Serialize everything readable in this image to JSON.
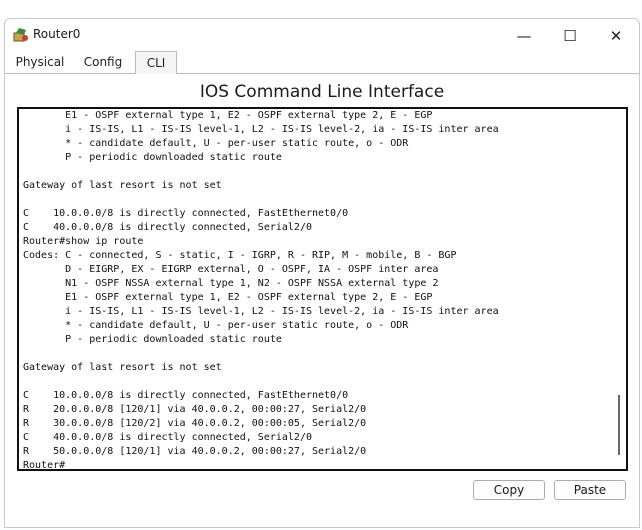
{
  "window": {
    "title": "Router0",
    "icon": "router-icon",
    "controls": {
      "minimize": "—",
      "maximize": "☐",
      "close": "✕"
    }
  },
  "tabs": [
    {
      "label": "Physical",
      "active": false
    },
    {
      "label": "Config",
      "active": false
    },
    {
      "label": "CLI",
      "active": true
    }
  ],
  "cli": {
    "title": "IOS Command Line Interface",
    "lines": [
      "       E1 - OSPF external type 1, E2 - OSPF external type 2, E - EGP",
      "       i - IS-IS, L1 - IS-IS level-1, L2 - IS-IS level-2, ia - IS-IS inter area",
      "       * - candidate default, U - per-user static route, o - ODR",
      "       P - periodic downloaded static route",
      "",
      "Gateway of last resort is not set",
      "",
      "C    10.0.0.0/8 is directly connected, FastEthernet0/0",
      "C    40.0.0.0/8 is directly connected, Serial2/0",
      "Router#show ip route",
      "Codes: C - connected, S - static, I - IGRP, R - RIP, M - mobile, B - BGP",
      "       D - EIGRP, EX - EIGRP external, O - OSPF, IA - OSPF inter area",
      "       N1 - OSPF NSSA external type 1, N2 - OSPF NSSA external type 2",
      "       E1 - OSPF external type 1, E2 - OSPF external type 2, E - EGP",
      "       i - IS-IS, L1 - IS-IS level-1, L2 - IS-IS level-2, ia - IS-IS inter area",
      "       * - candidate default, U - per-user static route, o - ODR",
      "       P - periodic downloaded static route",
      "",
      "Gateway of last resort is not set",
      "",
      "C    10.0.0.0/8 is directly connected, FastEthernet0/0",
      "R    20.0.0.0/8 [120/1] via 40.0.0.2, 00:00:27, Serial2/0",
      "R    30.0.0.0/8 [120/2] via 40.0.0.2, 00:00:05, Serial2/0",
      "C    40.0.0.0/8 is directly connected, Serial2/0",
      "R    50.0.0.0/8 [120/1] via 40.0.0.2, 00:00:27, Serial2/0",
      "Router#"
    ]
  },
  "buttons": {
    "copy": "Copy",
    "paste": "Paste"
  }
}
